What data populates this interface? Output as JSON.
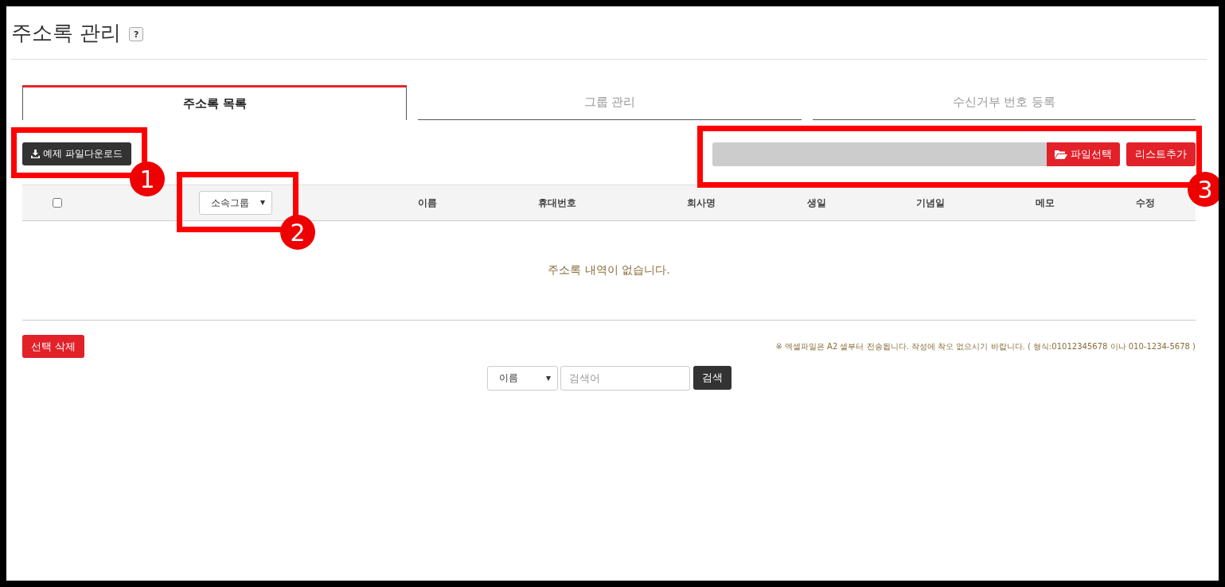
{
  "title": "주소록 관리",
  "help": "?",
  "tabs": [
    {
      "label": "주소록 목록",
      "selected": true
    },
    {
      "label": "그룹 관리",
      "selected": false
    },
    {
      "label": "수신거부 번호 등록",
      "selected": false
    }
  ],
  "toolbar": {
    "download_button": "예제 파일다운로드",
    "file_button": "파일선택",
    "add_button": "리스트추가"
  },
  "table": {
    "select_all_checked": false,
    "group_select": "소속그룹",
    "columns": [
      "이름",
      "휴대번호",
      "회사명",
      "생일",
      "기념일",
      "메모",
      "수정"
    ],
    "empty_message": "주소록 내역이 없습니다."
  },
  "delete_button": "선택 삭제",
  "notice": "※ 엑셀파일은 A2 셀부터 전송됩니다. 작성에 착오 없으시기 바랍니다. ( 형식:01012345678 이나 010-1234-5678 )",
  "search": {
    "field_select": "이름",
    "placeholder": "검색어",
    "button": "검색"
  },
  "annotations": [
    {
      "number": "1"
    },
    {
      "number": "2"
    },
    {
      "number": "3"
    }
  ]
}
